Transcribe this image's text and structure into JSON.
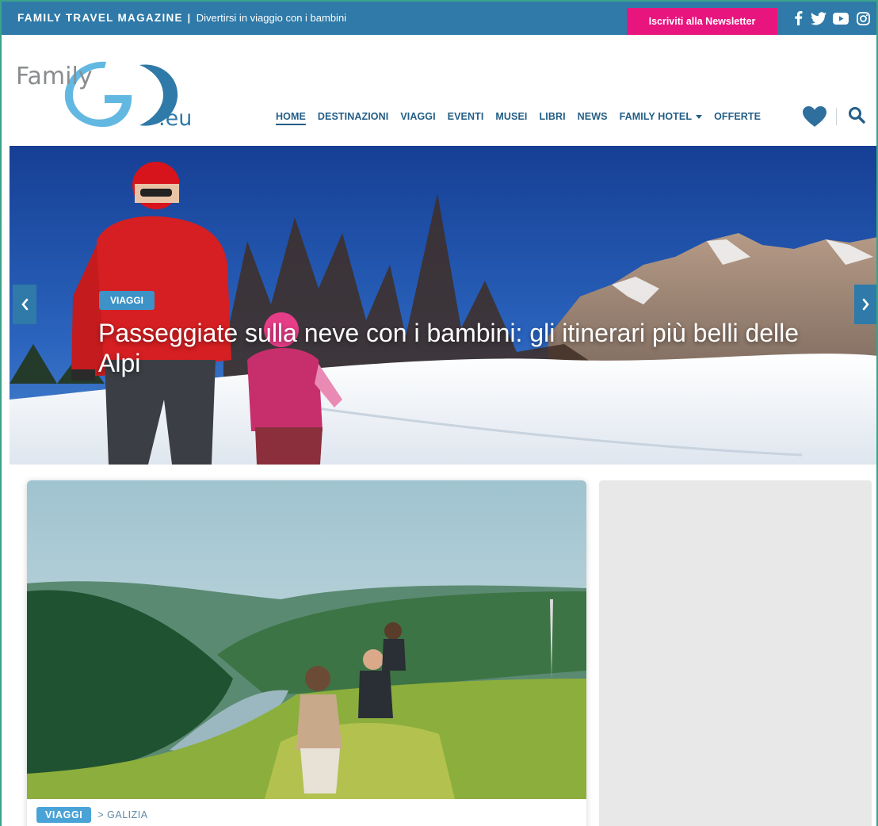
{
  "topbar": {
    "brand": "FAMILY TRAVEL MAGAZINE",
    "separator": "|",
    "tagline": "Divertirsi in viaggio con i bambini",
    "newsletter_label": "Iscriviti alla Newsletter",
    "social_icons": [
      "facebook-icon",
      "twitter-icon",
      "youtube-icon",
      "instagram-icon"
    ]
  },
  "logo": {
    "text_family": "Family",
    "text_go": "GO",
    "text_eu": ".eu"
  },
  "nav": {
    "items": [
      {
        "label": "HOME",
        "active": true
      },
      {
        "label": "DESTINAZIONI"
      },
      {
        "label": "VIAGGI"
      },
      {
        "label": "EVENTI"
      },
      {
        "label": "MUSEI"
      },
      {
        "label": "LIBRI"
      },
      {
        "label": "NEWS"
      },
      {
        "label": "FAMILY HOTEL",
        "dropdown": true
      },
      {
        "label": "OFFERTE"
      }
    ],
    "icons": [
      "heart-icon",
      "search-icon"
    ]
  },
  "hero": {
    "category": "VIAGGI",
    "title": "Passeggiate sulla neve con i bambini: gli itinerari più belli delle Alpi",
    "icons": [
      "chevron-left-icon",
      "chevron-right-icon"
    ]
  },
  "card": {
    "category": "VIAGGI",
    "subcategory": "> GALIZIA"
  },
  "colors": {
    "topbar": "#2f7aa8",
    "newsletter": "#e8157e",
    "nav_text": "#235e86",
    "badge": "#3d92c7",
    "frame_border": "#3aa38a",
    "sidebar_placeholder": "#e8e8e8"
  }
}
